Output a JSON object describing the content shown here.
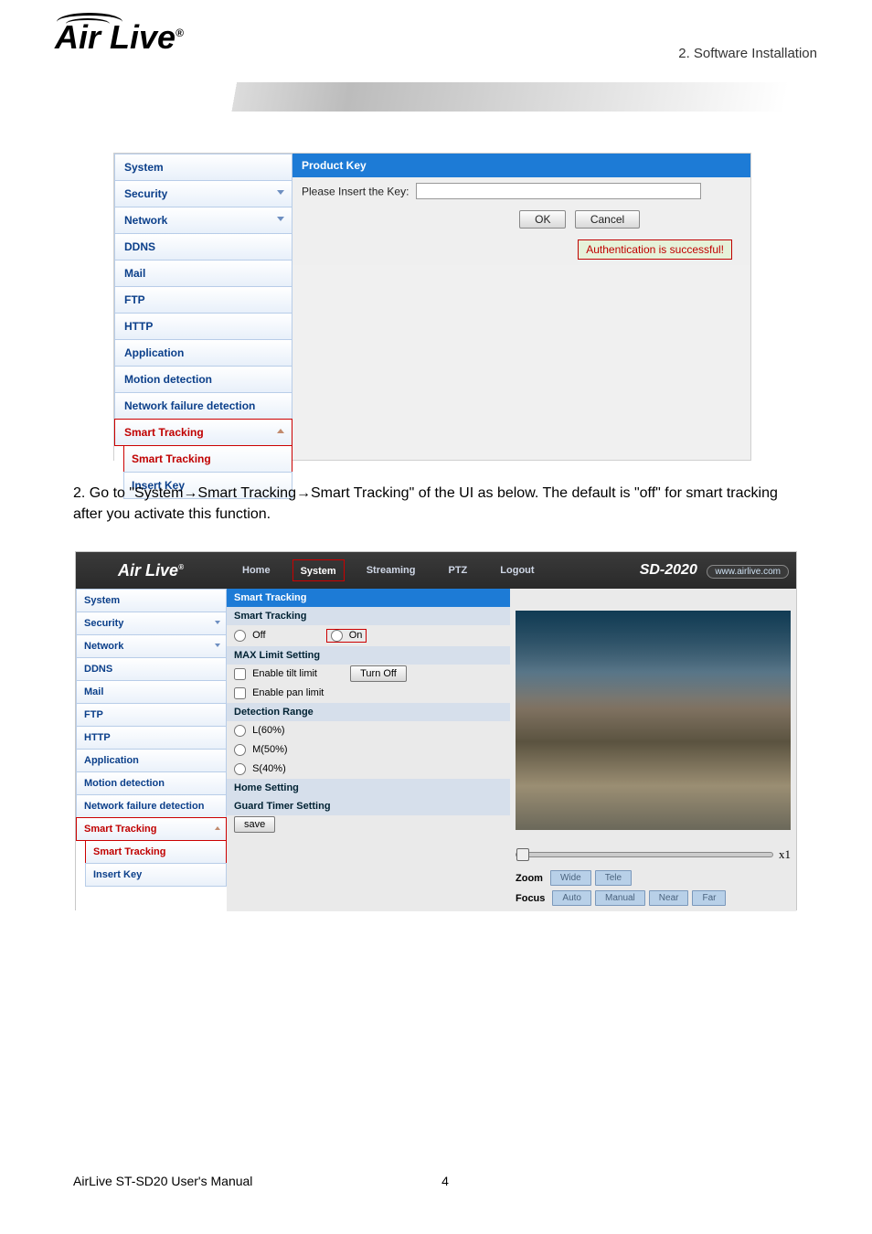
{
  "doc": {
    "header_right": "2.  Software  Installation",
    "step_text": "2. Go to \"System→Smart Tracking→Smart Tracking\" of the UI as below. The default is \"off\" for smart tracking after you activate this function.",
    "footer_left": "AirLive ST-SD20 User's Manual",
    "page_number": "4"
  },
  "shot1": {
    "sidebar": {
      "items": [
        {
          "label": "System"
        },
        {
          "label": "Security",
          "caret": "down"
        },
        {
          "label": "Network",
          "caret": "down"
        },
        {
          "label": "DDNS"
        },
        {
          "label": "Mail"
        },
        {
          "label": "FTP"
        },
        {
          "label": "HTTP"
        },
        {
          "label": "Application"
        },
        {
          "label": "Motion detection"
        },
        {
          "label": "Network failure detection"
        },
        {
          "label": "Smart Tracking",
          "caret": "up",
          "red": true
        }
      ],
      "sub": [
        {
          "label": "Smart Tracking",
          "red": true
        },
        {
          "label": "Insert Key"
        }
      ]
    },
    "section_title": "Product Key",
    "field_label": "Please Insert the Key:",
    "ok_label": "OK",
    "cancel_label": "Cancel",
    "auth_msg": "Authentication is successful!"
  },
  "shot2": {
    "topbar": {
      "tabs": [
        "Home",
        "System",
        "Streaming",
        "PTZ",
        "Logout"
      ],
      "product": "SD-2020",
      "url": "www.airlive.com"
    },
    "sidebar": {
      "items": [
        {
          "label": "System"
        },
        {
          "label": "Security",
          "caret": "down"
        },
        {
          "label": "Network",
          "caret": "down"
        },
        {
          "label": "DDNS"
        },
        {
          "label": "Mail"
        },
        {
          "label": "FTP"
        },
        {
          "label": "HTTP"
        },
        {
          "label": "Application"
        },
        {
          "label": "Motion detection"
        },
        {
          "label": "Network failure detection"
        },
        {
          "label": "Smart Tracking",
          "caret": "up",
          "red": true
        }
      ],
      "sub": [
        {
          "label": "Smart Tracking",
          "red": true
        },
        {
          "label": "Insert Key"
        }
      ]
    },
    "settings": {
      "panel_title": "Smart Tracking",
      "section_title": "Smart Tracking",
      "off_label": "Off",
      "on_label": "On",
      "max_limit_hdr": "MAX Limit Setting",
      "tilt_label": "Enable tilt limit",
      "turn_off_btn": "Turn Off",
      "pan_label": "Enable pan limit",
      "detection_hdr": "Detection Range",
      "range_L": "L(60%)",
      "range_M": "M(50%)",
      "range_S": "S(40%)",
      "home_hdr": "Home Setting",
      "guard_hdr": "Guard Timer Setting",
      "save_btn": "save"
    },
    "ptz": {
      "zoom_label": "Zoom",
      "wide": "Wide",
      "tele": "Tele",
      "focus_label": "Focus",
      "auto": "Auto",
      "manual": "Manual",
      "near": "Near",
      "far": "Far",
      "x1": "x1"
    }
  }
}
